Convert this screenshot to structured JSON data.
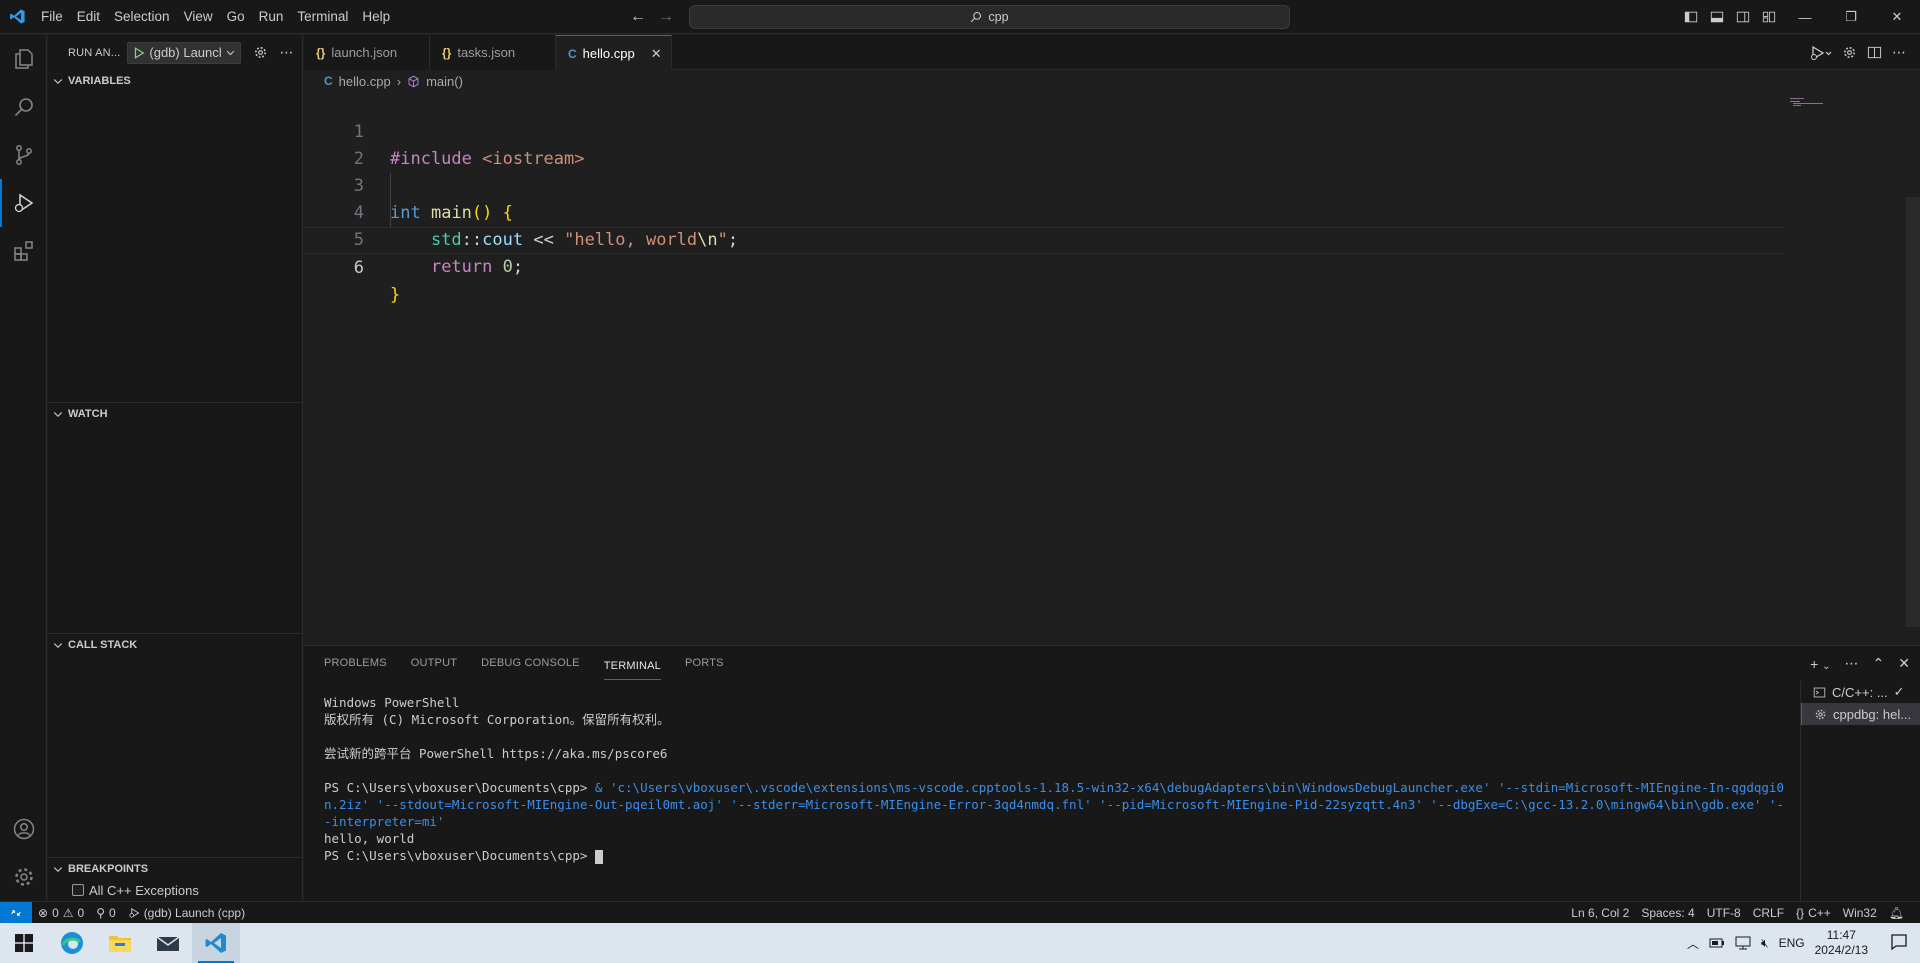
{
  "menu": [
    "File",
    "Edit",
    "Selection",
    "View",
    "Go",
    "Run",
    "Terminal",
    "Help"
  ],
  "search": {
    "text": "cpp"
  },
  "sidebar": {
    "run_title": "RUN AN...",
    "config_label": "(gdb) Launch (cpp)",
    "sections": {
      "variables": "VARIABLES",
      "watch": "WATCH",
      "call_stack": "CALL STACK",
      "breakpoints": "BREAKPOINTS"
    },
    "breakpoint_item": "All C++ Exceptions"
  },
  "tabs": [
    {
      "label": "launch.json",
      "icon": "{}"
    },
    {
      "label": "tasks.json",
      "icon": "{}"
    },
    {
      "label": "hello.cpp",
      "icon": "C",
      "active": true
    }
  ],
  "breadcrumb": {
    "file": "hello.cpp",
    "symbol": "main()"
  },
  "editor": {
    "line_numbers": [
      "1",
      "2",
      "3",
      "4",
      "5",
      "6"
    ],
    "current_line": 6
  },
  "panel": {
    "tabs": [
      "PROBLEMS",
      "OUTPUT",
      "DEBUG CONSOLE",
      "TERMINAL",
      "PORTS"
    ],
    "active_tab": "TERMINAL",
    "terminal_lines": [
      "Windows PowerShell",
      "版权所有 (C) Microsoft Corporation。保留所有权利。",
      "",
      "尝试新的跨平台 PowerShell https://aka.ms/pscore6",
      ""
    ],
    "prompt": "PS C:\\Users\\vboxuser\\Documents\\cpp>",
    "command": " & 'c:\\Users\\vboxuser\\.vscode\\extensions\\ms-vscode.cpptools-1.18.5-win32-x64\\debugAdapters\\bin\\WindowsDebugLauncher.exe' '--stdin=Microsoft-MIEngine-In-qgdqgi0n.2iz' '--stdout=Microsoft-MIEngine-Out-pqeil0mt.aoj' '--stderr=Microsoft-MIEngine-Error-3qd4nmdq.fnl' '--pid=Microsoft-MIEngine-Pid-22syzqtt.4n3' '--dbgExe=C:\\gcc-13.2.0\\mingw64\\bin\\gdb.exe' '--interpreter=mi'",
    "output": "hello, world",
    "final_prompt": "PS C:\\Users\\vboxuser\\Documents\\cpp>",
    "terminal_list": [
      "C/C++: ...",
      "cppdbg: hel..."
    ]
  },
  "statusbar": {
    "errors": "0",
    "warnings": "0",
    "ports": "0",
    "debug": "(gdb) Launch (cpp)",
    "position": "Ln 6, Col 2",
    "spaces": "Spaces: 4",
    "encoding": "UTF-8",
    "eol": "CRLF",
    "language": "C++",
    "platform": "Win32"
  },
  "taskbar": {
    "lang": "ENG",
    "time": "11:47",
    "date": "2024/2/13"
  },
  "colors": {
    "accent": "#0078d4",
    "editor_bg": "#1f1f1f",
    "chrome_bg": "#181818"
  }
}
